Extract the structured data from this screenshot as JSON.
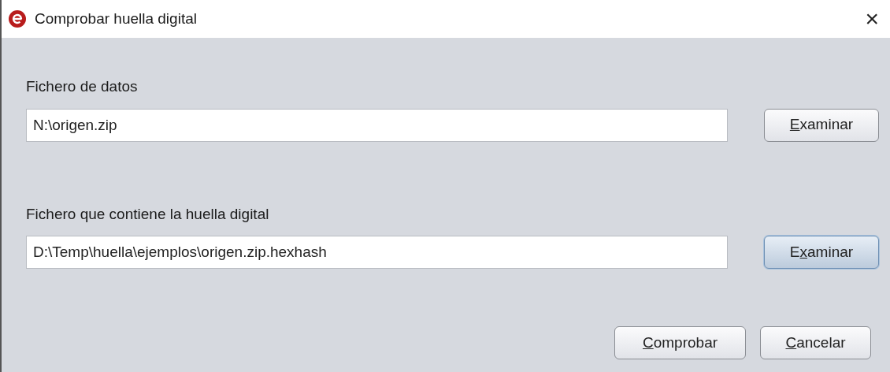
{
  "window": {
    "title": "Comprobar huella digital",
    "close": "×"
  },
  "fields": [
    {
      "label": "Fichero de datos",
      "value": "N:\\origen.zip",
      "button": {
        "label_parts": [
          {
            "text": "E",
            "underlined": true
          },
          {
            "text": "xaminar",
            "underlined": false
          }
        ],
        "focused": false
      }
    },
    {
      "label": "Fichero que contiene la huella digital",
      "value": "D:\\Temp\\huella\\ejemplos\\origen.zip.hexhash",
      "button": {
        "label_parts": [
          {
            "text": "E",
            "underlined": false
          },
          {
            "text": "x",
            "underlined": true
          },
          {
            "text": "aminar",
            "underlined": false
          }
        ],
        "focused": true
      }
    }
  ],
  "buttons": [
    {
      "label_parts": [
        {
          "text": "C",
          "underlined": true
        },
        {
          "text": "omprobar",
          "underlined": false
        }
      ],
      "focused": false
    },
    {
      "label_parts": [
        {
          "text": "C",
          "underlined": true
        },
        {
          "text": "ancelar",
          "underlined": false
        }
      ],
      "focused": false
    }
  ]
}
